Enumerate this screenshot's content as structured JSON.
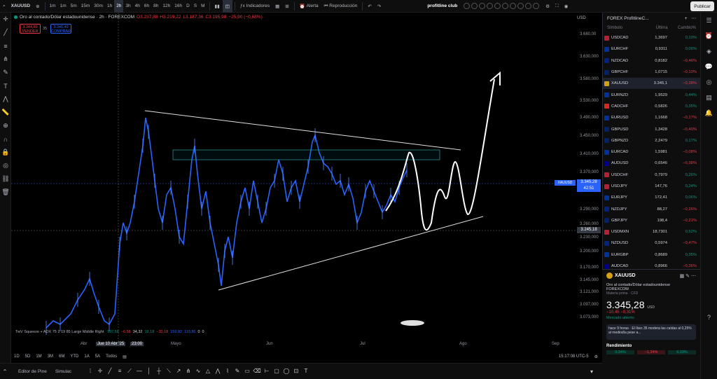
{
  "topbar": {
    "symbol": "XAUUSD",
    "timeframes": [
      "1m",
      "1m",
      "5m",
      "15m",
      "30m",
      "1h",
      "2h",
      "3h",
      "4h",
      "6h",
      "8h",
      "12h",
      "16h",
      "D",
      "S",
      "M"
    ],
    "active_tf": "2h",
    "indicators": "Indicadores",
    "alert": "Alerta",
    "replay": "Reproducción",
    "profile": "profitline club",
    "publish": "Publicar"
  },
  "info": {
    "title": "Oro al contado/Dólar estadounidense · 2h · FOREXCOM",
    "open": "O3.237,88",
    "high": "H3.219,22",
    "low": "L3.187,36",
    "close": "C3.195,98",
    "change": "−25,90 (−0,68%)"
  },
  "trade": {
    "sell_price": "3.344,89",
    "sell_label": "VENDER",
    "spread": "35",
    "buy_price": "3.345,49",
    "buy_label": "COMPRAR"
  },
  "currency": "USD",
  "price_ticks": [
    "3.680,00",
    "3.630,000",
    "3.580,000",
    "3.530,000",
    "3.490,000",
    "3.450,000",
    "3.410,000",
    "3.370,000",
    "3.290,000",
    "3.260,000",
    "3.230,000",
    "3.200,000",
    "3.170,000",
    "3.145,000",
    "3.121,000",
    "3.097,000",
    "3.073,000"
  ],
  "last_price_label": {
    "symbol": "XAUUSD",
    "price": "3.345,28",
    "timer": "42:51"
  },
  "cross_price": "3.245,18",
  "indicator_line": {
    "name": "TwV Squeeze + ADX 75 2 19 85 Large Middle Right",
    "values": [
      "107,58",
      "−6,58",
      "34,32",
      "19,18",
      "−30,18",
      "159,82",
      "119,86",
      "0",
      "0"
    ]
  },
  "time_ticks": [
    "Abr",
    "Jue 10 Abr '25",
    "23:00",
    "Mayo",
    "Jun",
    "Jul",
    "Ago",
    "Sep"
  ],
  "ranges": [
    "1D",
    "5D",
    "1M",
    "3M",
    "6M",
    "YTD",
    "1A",
    "5A",
    "Todos"
  ],
  "clock": "15:17:08 UTC-5",
  "bottom": {
    "editor": "Editor de Pine",
    "sim": "Simulac"
  },
  "watchlist": {
    "title": "FOREX ProfitlineC...",
    "cols": [
      "Símbolo",
      "Última",
      "Cambio%"
    ],
    "rows": [
      {
        "s": "USDCAD",
        "l": "1,3697",
        "c": "0,10%",
        "d": "pos",
        "f": "#b22234"
      },
      {
        "s": "EURCHF",
        "l": "0,9311",
        "c": "0,06%",
        "d": "pos",
        "f": "#003399"
      },
      {
        "s": "NZDCAD",
        "l": "0,8182",
        "c": "−0,46%",
        "d": "neg",
        "f": "#00247d"
      },
      {
        "s": "GBPCHF",
        "l": "1,0715",
        "c": "−0,10%",
        "d": "neg",
        "f": "#012169"
      },
      {
        "s": "XAUUSD",
        "l": "3.345,1",
        "c": "−0,38%",
        "d": "neg",
        "f": "#d4a017",
        "sel": true
      },
      {
        "s": "EURNZD",
        "l": "1,9529",
        "c": "0,44%",
        "d": "pos",
        "f": "#003399"
      },
      {
        "s": "CADCHF",
        "l": "0,5826",
        "c": "0,35%",
        "d": "pos",
        "f": "#d52b1e"
      },
      {
        "s": "EURUSD",
        "l": "1,1668",
        "c": "−0,17%",
        "d": "neg",
        "f": "#003399"
      },
      {
        "s": "GBPUSD",
        "l": "1,3428",
        "c": "−0,40%",
        "d": "neg",
        "f": "#012169"
      },
      {
        "s": "GBPNZD",
        "l": "2,2479",
        "c": "0,17%",
        "d": "pos",
        "f": "#012169"
      },
      {
        "s": "EURCAD",
        "l": "1,5981",
        "c": "−0,08%",
        "d": "neg",
        "f": "#003399"
      },
      {
        "s": "AUDUSD",
        "l": "0,6546",
        "c": "−0,38%",
        "d": "neg",
        "f": "#00008b"
      },
      {
        "s": "USDCHF",
        "l": "0,7979",
        "c": "0,26%",
        "d": "pos",
        "f": "#b22234"
      },
      {
        "s": "USDJPY",
        "l": "147,76",
        "c": "0,24%",
        "d": "pos",
        "f": "#b22234"
      },
      {
        "s": "EURJPY",
        "l": "172,41",
        "c": "0,06%",
        "d": "pos",
        "f": "#003399"
      },
      {
        "s": "NZDJPY",
        "l": "88,27",
        "c": "−0,26%",
        "d": "neg",
        "f": "#00247d"
      },
      {
        "s": "GBPJPY",
        "l": "198,4",
        "c": "−0,21%",
        "d": "neg",
        "f": "#012169"
      },
      {
        "s": "USDMXN",
        "l": "18,7301",
        "c": "0,52%",
        "d": "pos",
        "f": "#b22234"
      },
      {
        "s": "NZDUSD",
        "l": "0,5974",
        "c": "−0,47%",
        "d": "neg",
        "f": "#00247d"
      },
      {
        "s": "EURGBP",
        "l": "0,8689",
        "c": "0,35%",
        "d": "pos",
        "f": "#003399"
      },
      {
        "s": "AUDCAD",
        "l": "0,8966",
        "c": "−0,36%",
        "d": "neg",
        "f": "#00008b"
      },
      {
        "s": "AUDJPY",
        "l": "96,72",
        "c": "−0,12%",
        "d": "neg",
        "f": "#00008b"
      }
    ]
  },
  "detail": {
    "symbol": "XAUUSD",
    "name": "Oro al contado/Dólar estadounidense",
    "exchange": "FOREXCOM",
    "type": "Materia prima · CFD",
    "price": "3.345,28",
    "currency": "USD",
    "change": "−10,45  −0,31%",
    "market": "Mercado abierto",
    "news": "hace 9 horas · El Ibex 35 modera las caídas al 0,25% al mediodía pese a...",
    "perf": "Rendimiento",
    "perf_vals": [
      "0,34%",
      "−1,34%",
      "6,19%"
    ]
  }
}
